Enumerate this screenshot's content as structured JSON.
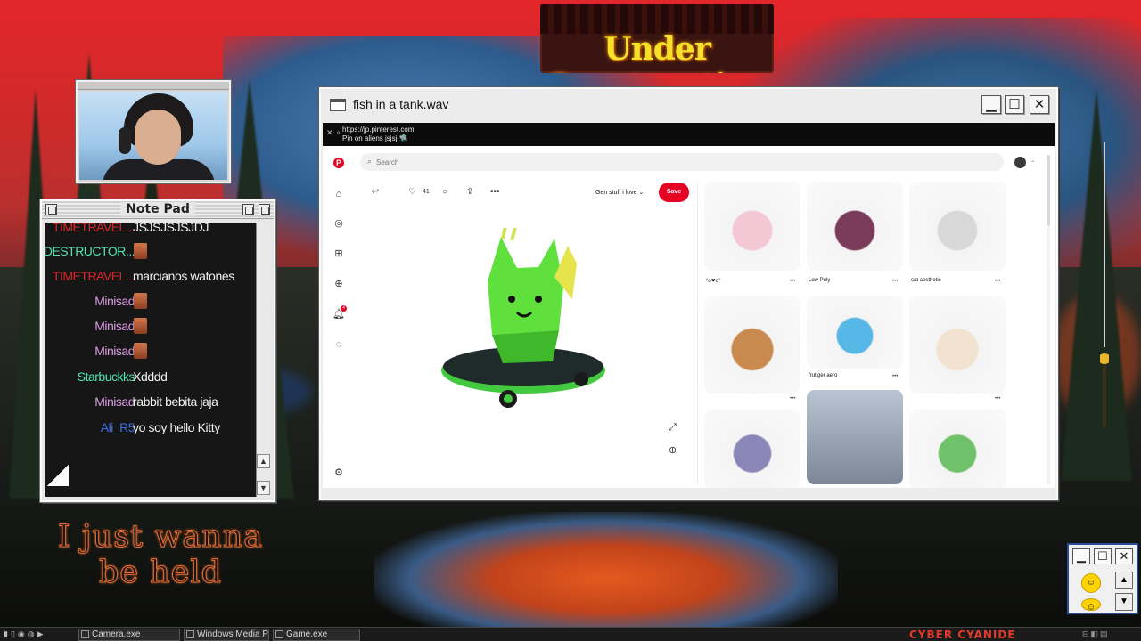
{
  "banner": {
    "text": "Under Construction"
  },
  "notepad": {
    "title": "Note Pad",
    "messages": [
      {
        "user": "TIMETRAVEL...",
        "text": "JSJSJSJSJDJ",
        "color": "#d9262c",
        "emote": false
      },
      {
        "user": "DESTRUCTOR...",
        "text": "",
        "color": "#4fe3b4",
        "emote": true
      },
      {
        "user": "TIMETRAVEL...",
        "text": "marcianos watones",
        "color": "#d9262c",
        "emote": false
      },
      {
        "user": "Minisad",
        "text": "",
        "color": "#d89be0",
        "emote": true
      },
      {
        "user": "Minisad",
        "text": "",
        "color": "#d89be0",
        "emote": true
      },
      {
        "user": "Minisad",
        "text": "",
        "color": "#d89be0",
        "emote": true
      },
      {
        "user": "Starbuckks",
        "text": "Xdddd",
        "color": "#4fe3b4",
        "emote": false
      },
      {
        "user": "Minisad",
        "text": "rabbit bebita jaja",
        "color": "#d89be0",
        "emote": false
      },
      {
        "user": "Ali_R5",
        "text": "yo soy hello Kitty",
        "color": "#3d6fe0",
        "emote": false
      }
    ]
  },
  "overlay_text": {
    "line1": "I just wanna",
    "line2": "be held"
  },
  "window": {
    "title": "fish in a tank.wav",
    "minimize": "▁",
    "maximize": "☐",
    "close": "✕",
    "address": {
      "url": "https://jp.pinterest.com",
      "subtitle": "Pin on aliens jsjsj 🛸"
    }
  },
  "pinterest": {
    "logo": "P",
    "search_placeholder": "Search",
    "notification_count": "4",
    "pin": {
      "likes": "41",
      "board": "Gen stuff i love",
      "board_chevron": "⌄",
      "save_label": "Save"
    },
    "grid": [
      {
        "label": "°o❤o°",
        "color": "#f3c7d3"
      },
      {
        "label": "Low Poly",
        "color": "#7a3a5a"
      },
      {
        "label": "cat aesthetic",
        "color": "#d8d8d8"
      },
      {
        "label": "",
        "color": "#c88a4f"
      },
      {
        "label": "frutiger aero",
        "color": "#57b7e6"
      },
      {
        "label": "",
        "color": "#f1e3cf"
      },
      {
        "label": "",
        "color": "#8b86b8"
      },
      {
        "label": "",
        "color": "#9aa6b5"
      },
      {
        "label": "",
        "color": "#6fc26a"
      }
    ]
  },
  "taskbar": {
    "tasks": [
      "Camera.exe",
      "Windows Media Pla",
      "Game.exe"
    ],
    "brand": "CYBER CYANIDE"
  },
  "colors": {
    "pinterest_red": "#e60023",
    "sky_red": "#e3262a",
    "banner_yellow": "#f6e12a"
  }
}
